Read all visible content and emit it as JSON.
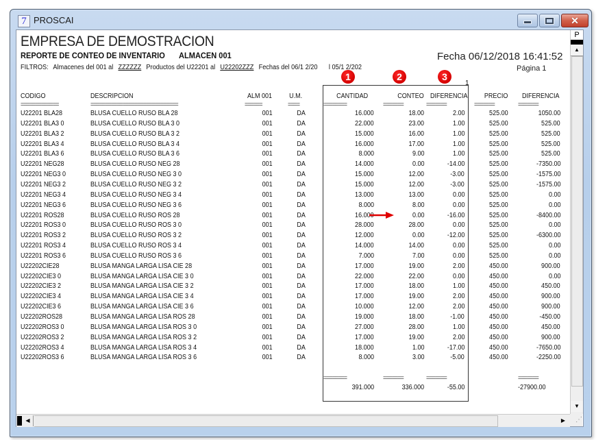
{
  "window": {
    "title": "PROSCAI",
    "app_icon_glyph": "7",
    "controls": {
      "minimize": "minimize-icon",
      "maximize": "maximize-icon",
      "close": "close-icon"
    }
  },
  "report": {
    "company": "EMPRESA DE DEMOSTRACION",
    "title": "REPORTE DE CONTEO DE INVENTARIO",
    "warehouse": "ALMACEN 001",
    "filters": {
      "label": "FILTROS:",
      "almacenes": "Almacenes del 001 al",
      "almacenes_to": "ZZZZZZ",
      "productos": "Productos del U22201 al",
      "productos_to": "U22202ZZZ",
      "fechas": "Fechas del 06/1 2/20",
      "fechas_to": "l 05/1 2/202"
    },
    "fecha": "Fecha 06/12/2018 16:41:52",
    "pagina": "Página 1",
    "page_mark": "1",
    "badges": [
      "1",
      "2",
      "3"
    ],
    "columns": {
      "codigo": "CODIGO",
      "descripcion": "DESCRIPCION",
      "alm": "ALM 001",
      "um": "U.M.",
      "cantidad": "CANTIDAD",
      "conteo": "CONTEO",
      "diferencia": "DIFERENCIA",
      "precio": "PRECIO",
      "diferencia2": "DIFERENCIA"
    },
    "separators": {
      "codigo": "=============",
      "descripcion": "==============================",
      "alm": "======",
      "um": "====",
      "cantidad": "========",
      "conteo": "=======",
      "diferencia": "=======",
      "precio": "=======",
      "diferencia2": "======="
    },
    "rows": [
      {
        "codigo": "U22201 BLA28",
        "descripcion": "BLUSA  CUELLO RUSO BLA 28",
        "alm": "001",
        "um": "DA",
        "cantidad": "16.000",
        "conteo": "18.00",
        "diferencia": "2.00",
        "precio": "525.00",
        "diferencia2": "1050.00"
      },
      {
        "codigo": "U22201 BLA3 0",
        "descripcion": "BLUSA  CUELLO RUSO BLA 3 0",
        "alm": "001",
        "um": "DA",
        "cantidad": "22.000",
        "conteo": "23.00",
        "diferencia": "1.00",
        "precio": "525.00",
        "diferencia2": "525.00"
      },
      {
        "codigo": "U22201 BLA3 2",
        "descripcion": "BLUSA  CUELLO RUSO BLA 3 2",
        "alm": "001",
        "um": "DA",
        "cantidad": "15.000",
        "conteo": "16.00",
        "diferencia": "1.00",
        "precio": "525.00",
        "diferencia2": "525.00"
      },
      {
        "codigo": "U22201 BLA3 4",
        "descripcion": "BLUSA  CUELLO RUSO BLA 3 4",
        "alm": "001",
        "um": "DA",
        "cantidad": "16.000",
        "conteo": "17.00",
        "diferencia": "1.00",
        "precio": "525.00",
        "diferencia2": "525.00"
      },
      {
        "codigo": "U22201 BLA3 6",
        "descripcion": "BLUSA  CUELLO RUSO BLA 3 6",
        "alm": "001",
        "um": "DA",
        "cantidad": "8.000",
        "conteo": "9.00",
        "diferencia": "1.00",
        "precio": "525.00",
        "diferencia2": "525.00"
      },
      {
        "codigo": "U22201 NEG28",
        "descripcion": "BLUSA  CUELLO RUSO NEG 28",
        "alm": "001",
        "um": "DA",
        "cantidad": "14.000",
        "conteo": "0.00",
        "diferencia": "-14.00",
        "precio": "525.00",
        "diferencia2": "-7350.00"
      },
      {
        "codigo": "U22201 NEG3 0",
        "descripcion": "BLUSA  CUELLO RUSO NEG 3 0",
        "alm": "001",
        "um": "DA",
        "cantidad": "15.000",
        "conteo": "12.00",
        "diferencia": "-3.00",
        "precio": "525.00",
        "diferencia2": "-1575.00"
      },
      {
        "codigo": "U22201 NEG3 2",
        "descripcion": "BLUSA  CUELLO RUSO NEG 3 2",
        "alm": "001",
        "um": "DA",
        "cantidad": "15.000",
        "conteo": "12.00",
        "diferencia": "-3.00",
        "precio": "525.00",
        "diferencia2": "-1575.00"
      },
      {
        "codigo": "U22201 NEG3 4",
        "descripcion": "BLUSA  CUELLO RUSO NEG 3 4",
        "alm": "001",
        "um": "DA",
        "cantidad": "13.000",
        "conteo": "13.00",
        "diferencia": "0.00",
        "precio": "525.00",
        "diferencia2": "0.00"
      },
      {
        "codigo": "U22201 NEG3 6",
        "descripcion": "BLUSA  CUELLO RUSO NEG 3 6",
        "alm": "001",
        "um": "DA",
        "cantidad": "8.000",
        "conteo": "8.00",
        "diferencia": "0.00",
        "precio": "525.00",
        "diferencia2": "0.00"
      },
      {
        "codigo": "U22201 ROS28",
        "descripcion": "BLUSA  CUELLO RUSO ROS 28",
        "alm": "001",
        "um": "DA",
        "cantidad": "16.000",
        "conteo": "0.00",
        "diferencia": "-16.00",
        "precio": "525.00",
        "diferencia2": "-8400.00"
      },
      {
        "codigo": "U22201 ROS3 0",
        "descripcion": "BLUSA  CUELLO RUSO ROS 3 0",
        "alm": "001",
        "um": "DA",
        "cantidad": "28.000",
        "conteo": "28.00",
        "diferencia": "0.00",
        "precio": "525.00",
        "diferencia2": "0.00"
      },
      {
        "codigo": "U22201 ROS3 2",
        "descripcion": "BLUSA  CUELLO RUSO ROS 3 2",
        "alm": "001",
        "um": "DA",
        "cantidad": "12.000",
        "conteo": "0.00",
        "diferencia": "-12.00",
        "precio": "525.00",
        "diferencia2": "-6300.00"
      },
      {
        "codigo": "U22201 ROS3 4",
        "descripcion": "BLUSA  CUELLO RUSO ROS 3 4",
        "alm": "001",
        "um": "DA",
        "cantidad": "14.000",
        "conteo": "14.00",
        "diferencia": "0.00",
        "precio": "525.00",
        "diferencia2": "0.00"
      },
      {
        "codigo": "U22201 ROS3 6",
        "descripcion": "BLUSA  CUELLO RUSO ROS 3 6",
        "alm": "001",
        "um": "DA",
        "cantidad": "7.000",
        "conteo": "7.00",
        "diferencia": "0.00",
        "precio": "525.00",
        "diferencia2": "0.00"
      },
      {
        "codigo": "U22202CIE28",
        "descripcion": "BLUSA MANGA LARGA  LISA  CIE 28",
        "alm": "001",
        "um": "DA",
        "cantidad": "17.000",
        "conteo": "19.00",
        "diferencia": "2.00",
        "precio": "450.00",
        "diferencia2": "900.00"
      },
      {
        "codigo": "U22202CIE3 0",
        "descripcion": "BLUSA MANGA LARGA  LISA  CIE 3 0",
        "alm": "001",
        "um": "DA",
        "cantidad": "22.000",
        "conteo": "22.00",
        "diferencia": "0.00",
        "precio": "450.00",
        "diferencia2": "0.00"
      },
      {
        "codigo": "U22202CIE3 2",
        "descripcion": "BLUSA MANGA LARGA  LISA  CIE 3 2",
        "alm": "001",
        "um": "DA",
        "cantidad": "17.000",
        "conteo": "18.00",
        "diferencia": "1.00",
        "precio": "450.00",
        "diferencia2": "450.00"
      },
      {
        "codigo": "U22202CIE3 4",
        "descripcion": "BLUSA MANGA LARGA  LISA  CIE 3 4",
        "alm": "001",
        "um": "DA",
        "cantidad": "17.000",
        "conteo": "19.00",
        "diferencia": "2.00",
        "precio": "450.00",
        "diferencia2": "900.00"
      },
      {
        "codigo": "U22202CIE3 6",
        "descripcion": "BLUSA MANGA LARGA  LISA  CIE 3 6",
        "alm": "001",
        "um": "DA",
        "cantidad": "10.000",
        "conteo": "12.00",
        "diferencia": "2.00",
        "precio": "450.00",
        "diferencia2": "900.00"
      },
      {
        "codigo": "U22202ROS28",
        "descripcion": "BLUSA MANGA LARGA  LISA  ROS 28",
        "alm": "001",
        "um": "DA",
        "cantidad": "19.000",
        "conteo": "18.00",
        "diferencia": "-1.00",
        "precio": "450.00",
        "diferencia2": "-450.00"
      },
      {
        "codigo": "U22202ROS3 0",
        "descripcion": "BLUSA MANGA LARGA  LISA  ROS 3 0",
        "alm": "001",
        "um": "DA",
        "cantidad": "27.000",
        "conteo": "28.00",
        "diferencia": "1.00",
        "precio": "450.00",
        "diferencia2": "450.00"
      },
      {
        "codigo": "U22202ROS3 2",
        "descripcion": "BLUSA MANGA LARGA  LISA  ROS 3 2",
        "alm": "001",
        "um": "DA",
        "cantidad": "17.000",
        "conteo": "19.00",
        "diferencia": "2.00",
        "precio": "450.00",
        "diferencia2": "900.00"
      },
      {
        "codigo": "U22202ROS3 4",
        "descripcion": "BLUSA MANGA LARGA  LISA  ROS 3 4",
        "alm": "001",
        "um": "DA",
        "cantidad": "18.000",
        "conteo": "1.00",
        "diferencia": "-17.00",
        "precio": "450.00",
        "diferencia2": "-7650.00"
      },
      {
        "codigo": "U22202ROS3 6",
        "descripcion": "BLUSA MANGA LARGA  LISA  ROS 3 6",
        "alm": "001",
        "um": "DA",
        "cantidad": "8.000",
        "conteo": "3.00",
        "diferencia": "-5.00",
        "precio": "450.00",
        "diferencia2": "-2250.00"
      }
    ],
    "totals": {
      "separator_cantidad": "========",
      "separator_conteo": "=======",
      "separator_diferencia": "=======",
      "separator_diferencia2": "=======",
      "cantidad": "391.000",
      "conteo": "336.000",
      "diferencia": "-55.00",
      "diferencia2": "-27900.00"
    }
  },
  "scrollbar": {
    "page_button": "P"
  },
  "colors": {
    "badge": "#d40000",
    "arrow": "#e00000",
    "window_frame": "#b9d1ec",
    "close_button": "#c9503a"
  }
}
